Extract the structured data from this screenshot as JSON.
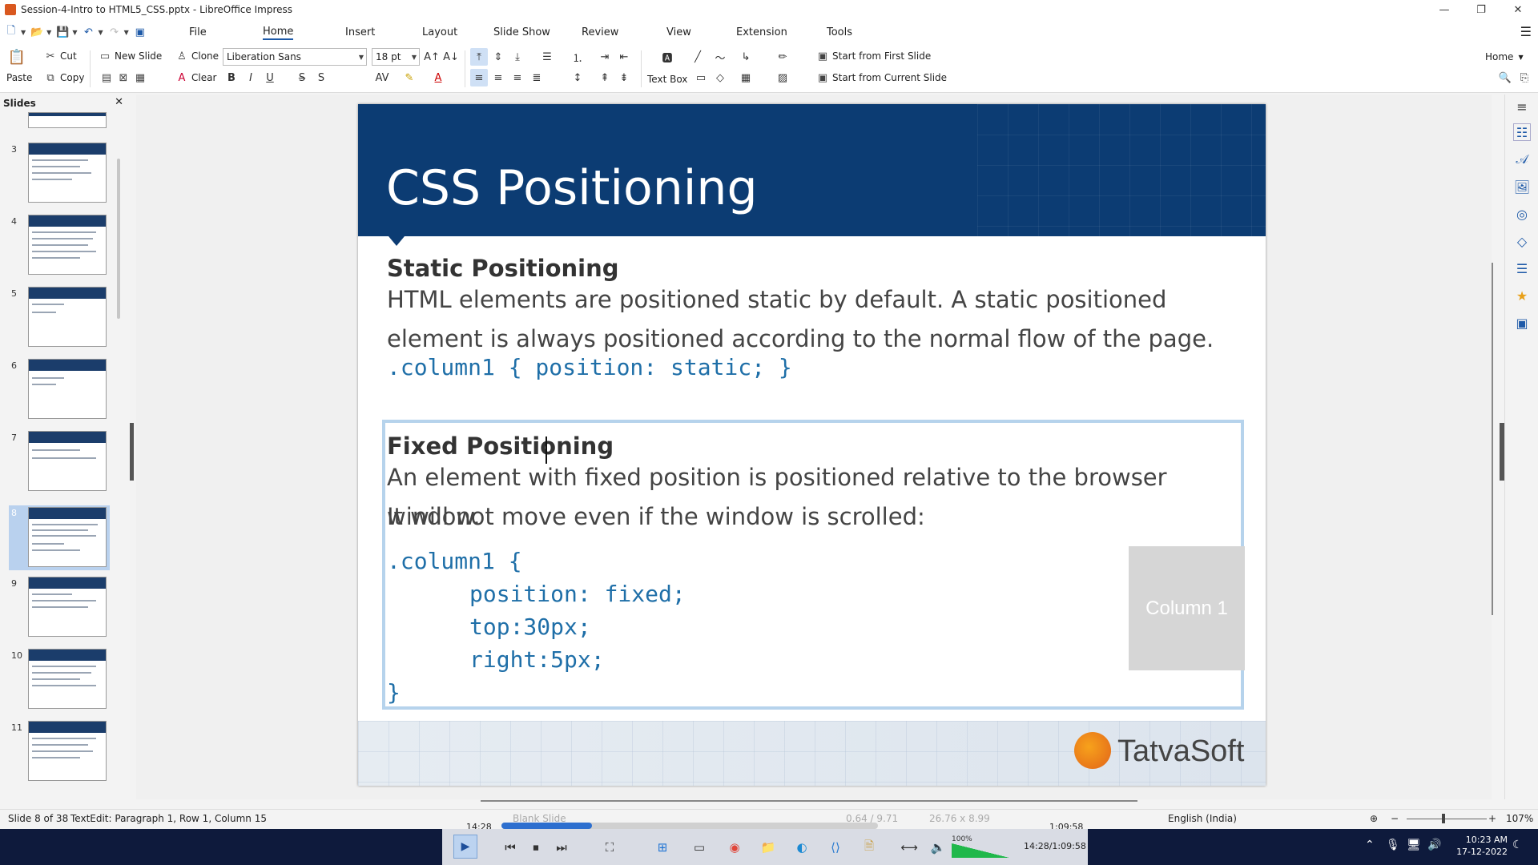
{
  "window": {
    "title": "Session-4-Intro to HTML5_CSS.pptx - LibreOffice Impress",
    "minimize": "—",
    "maximize": "❐",
    "close": "✕"
  },
  "menu": {
    "tabs": [
      "File",
      "Home",
      "Insert",
      "Layout",
      "Slide Show",
      "Review",
      "View",
      "Extension",
      "Tools"
    ],
    "active": "Home",
    "hamburger": "☰"
  },
  "ribbon": {
    "paste": "Paste",
    "cut": "Cut",
    "copy": "Copy",
    "new_slide": "New Slide",
    "clone": "Clone",
    "clear": "Clear",
    "font_name": "Liberation Sans",
    "font_size": "18 pt",
    "bold": "B",
    "italic": "I",
    "underline": "U",
    "strike": "S",
    "shadow": "S",
    "text_box": "Text Box",
    "start_first": "Start from First Slide",
    "start_current": "Start from Current Slide",
    "home_dropdown": "Home"
  },
  "slides_pane": {
    "title": "Slides",
    "close": "✕",
    "numbers": [
      "3",
      "4",
      "5",
      "6",
      "7",
      "8",
      "9",
      "10",
      "11"
    ],
    "selected": "8"
  },
  "slide": {
    "title": "CSS Positioning",
    "static_heading": "Static Positioning",
    "static_text": "HTML elements are positioned static by default. A static positioned element is always positioned according to the normal flow of the page.",
    "static_code": ".column1 { position: static; }",
    "fixed_heading": "Fixed Positioning",
    "fixed_text_1": "An element with fixed position is positioned relative to the browser window.",
    "fixed_text_2": "It will not move even if the window is scrolled:",
    "code_open": ".column1 {",
    "code_line_1": "position: fixed;",
    "code_line_2": "top:30px;",
    "code_line_3": "right:5px;",
    "code_close": "}",
    "column_box": "Column 1",
    "logo_text": "TatvaSoft"
  },
  "statusbar": {
    "slide_info": "Slide 8 of 38",
    "edit_info": "TextEdit: Paragraph 1, Row 1, Column 15",
    "media_start": "14:28",
    "media_end": "1:09:58",
    "layout_name": "Blank Slide",
    "position": "0.64 / 9.71",
    "size": "26.76 x 8.99",
    "language": "English (India)",
    "zoom": "107%",
    "media_progress": 0.24
  },
  "taskbar": {
    "volume": "100%",
    "time_display": "14:28/1:09:58",
    "clock_time": "10:23 AM",
    "clock_date": "17-12-2022"
  }
}
